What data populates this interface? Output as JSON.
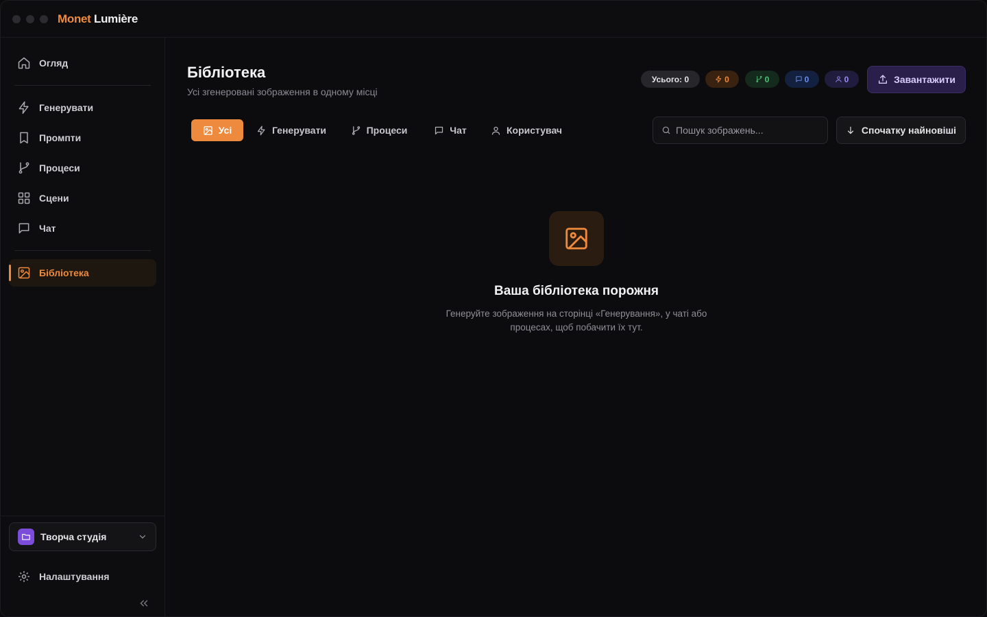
{
  "app": {
    "brand_part1": "Monet",
    "brand_part2": "Lumière"
  },
  "sidebar": {
    "items": [
      {
        "label": "Огляд",
        "icon": "home-icon"
      },
      {
        "label": "Генерувати",
        "icon": "bolt-icon"
      },
      {
        "label": "Промпти",
        "icon": "bookmark-icon"
      },
      {
        "label": "Процеси",
        "icon": "git-branch-icon"
      },
      {
        "label": "Сцени",
        "icon": "grid-icon"
      },
      {
        "label": "Чат",
        "icon": "chat-icon"
      },
      {
        "label": "Бібліотека",
        "icon": "image-icon",
        "active": true
      }
    ],
    "workspace": "Творча студія",
    "settings": "Налаштування"
  },
  "header": {
    "title": "Бібліотека",
    "subtitle": "Усі згенеровані зображення в одному місці"
  },
  "stats": {
    "total": "Усього: 0",
    "generate": "0",
    "processes": "0",
    "chat": "0",
    "user": "0"
  },
  "upload_label": "Завантажити",
  "tabs": [
    {
      "label": "Усі",
      "icon": "image-icon",
      "active": true
    },
    {
      "label": "Генерувати",
      "icon": "bolt-icon"
    },
    {
      "label": "Процеси",
      "icon": "git-branch-icon"
    },
    {
      "label": "Чат",
      "icon": "chat-icon"
    },
    {
      "label": "Користувач",
      "icon": "user-icon"
    }
  ],
  "search": {
    "placeholder": "Пошук зображень...",
    "value": ""
  },
  "sort_label": "Спочатку найновіші",
  "empty": {
    "title": "Ваша бібліотека порожня",
    "text": "Генеруйте зображення на сторінці «Генерування», у чаті або процесах, щоб побачити їх тут."
  },
  "colors": {
    "accent": "#ee8a3d",
    "workspace": "#7c4ddb",
    "process": "#4fc57c",
    "chat": "#6a8ff3",
    "user": "#9a8cf2"
  }
}
